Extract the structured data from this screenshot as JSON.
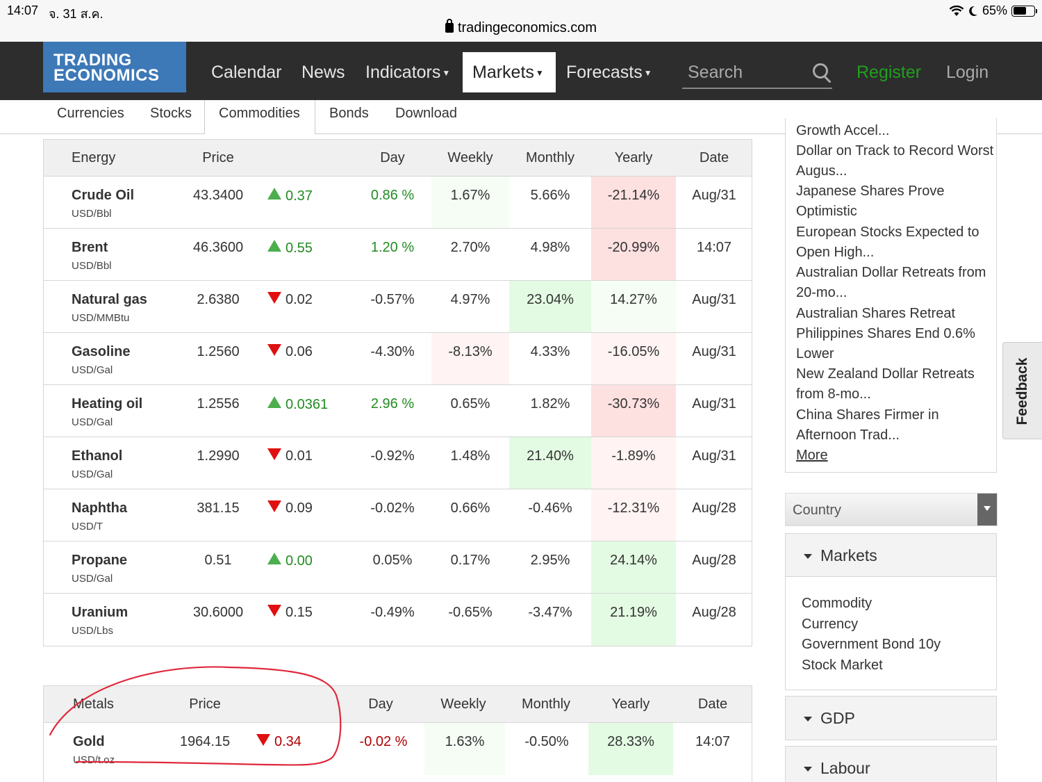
{
  "status_bar": {
    "time": "14:07",
    "date": "จ. 31 ส.ค.",
    "url": "tradingeconomics.com",
    "battery": "65%",
    "battery_level": 0.65
  },
  "nav": {
    "logo_line1": "TRADING",
    "logo_line2": "ECONOMICS",
    "items": [
      {
        "label": "Calendar"
      },
      {
        "label": "News"
      },
      {
        "label": "Indicators"
      },
      {
        "label": "Markets"
      },
      {
        "label": "Forecasts"
      }
    ],
    "search_placeholder": "Search",
    "register": "Register",
    "login": "Login"
  },
  "subnav": [
    "Currencies",
    "Stocks",
    "Commodities",
    "Bonds",
    "Download"
  ],
  "energy": {
    "headers": [
      "Energy",
      "Price",
      "Day",
      "Weekly",
      "Monthly",
      "Yearly",
      "Date"
    ],
    "rows": [
      {
        "name": "Crude Oil",
        "unit": "USD/Bbl",
        "price": "43.3400",
        "dir": "up",
        "change": "0.37",
        "day": "0.86 %",
        "weekly": "1.67%",
        "monthly": "5.66%",
        "yearly": "-21.14%",
        "date": "Aug/31"
      },
      {
        "name": "Brent",
        "unit": "USD/Bbl",
        "price": "46.3600",
        "dir": "up",
        "change": "0.55",
        "day": "1.20 %",
        "weekly": "2.70%",
        "monthly": "4.98%",
        "yearly": "-20.99%",
        "date": "14:07"
      },
      {
        "name": "Natural gas",
        "unit": "USD/MMBtu",
        "price": "2.6380",
        "dir": "down",
        "change": "0.02",
        "day": "-0.57%",
        "weekly": "4.97%",
        "monthly": "23.04%",
        "yearly": "14.27%",
        "date": "Aug/31"
      },
      {
        "name": "Gasoline",
        "unit": "USD/Gal",
        "price": "1.2560",
        "dir": "down",
        "change": "0.06",
        "day": "-4.30%",
        "weekly": "-8.13%",
        "monthly": "4.33%",
        "yearly": "-16.05%",
        "date": "Aug/31"
      },
      {
        "name": "Heating oil",
        "unit": "USD/Gal",
        "price": "1.2556",
        "dir": "up",
        "change": "0.0361",
        "day": "2.96 %",
        "weekly": "0.65%",
        "monthly": "1.82%",
        "yearly": "-30.73%",
        "date": "Aug/31"
      },
      {
        "name": "Ethanol",
        "unit": "USD/Gal",
        "price": "1.2990",
        "dir": "down",
        "change": "0.01",
        "day": "-0.92%",
        "weekly": "1.48%",
        "monthly": "21.40%",
        "yearly": "-1.89%",
        "date": "Aug/31"
      },
      {
        "name": "Naphtha",
        "unit": "USD/T",
        "price": "381.15",
        "dir": "down",
        "change": "0.09",
        "day": "-0.02%",
        "weekly": "0.66%",
        "monthly": "-0.46%",
        "yearly": "-12.31%",
        "date": "Aug/28"
      },
      {
        "name": "Propane",
        "unit": "USD/Gal",
        "price": "0.51",
        "dir": "up",
        "change": "0.00",
        "day": "0.05%",
        "weekly": "0.17%",
        "monthly": "2.95%",
        "yearly": "24.14%",
        "date": "Aug/28"
      },
      {
        "name": "Uranium",
        "unit": "USD/Lbs",
        "price": "30.6000",
        "dir": "down",
        "change": "0.15",
        "day": "-0.49%",
        "weekly": "-0.65%",
        "monthly": "-3.47%",
        "yearly": "21.19%",
        "date": "Aug/28"
      }
    ]
  },
  "metals": {
    "headers": [
      "Metals",
      "Price",
      "Day",
      "Weekly",
      "Monthly",
      "Yearly",
      "Date"
    ],
    "rows": [
      {
        "name": "Gold",
        "unit": "USD/t.oz",
        "price": "1964.15",
        "dir": "down",
        "change": "0.34",
        "day": "-0.02 %",
        "weekly": "1.63%",
        "monthly": "-0.50%",
        "yearly": "28.33%",
        "date": "14:07"
      }
    ]
  },
  "news": {
    "partial_top": "Growth Accel...",
    "items": [
      "Dollar on Track to Record Worst Augus...",
      "Japanese Shares Prove Optimistic",
      "European Stocks Expected to Open High...",
      "Australian Dollar Retreats from 20-mo...",
      "Australian Shares Retreat",
      "Philippines Shares End 0.6% Lower",
      "New Zealand Dollar Retreats from 8-mo...",
      "China Shares Firmer in Afternoon Trad..."
    ],
    "more": "More"
  },
  "country_select": "Country",
  "panels": [
    {
      "title": "Markets",
      "links": [
        "Commodity",
        "Currency",
        "Government Bond 10y",
        "Stock Market"
      ]
    },
    {
      "title": "GDP",
      "links": []
    },
    {
      "title": "Labour",
      "links": []
    }
  ],
  "feedback": "Feedback",
  "colors": {
    "navbar": "#2d2d2d",
    "logo": "#3d78b7",
    "register": "#1ea01e",
    "annotation": "#e0283c",
    "up": "#4cae4c",
    "down": "#e01010"
  }
}
